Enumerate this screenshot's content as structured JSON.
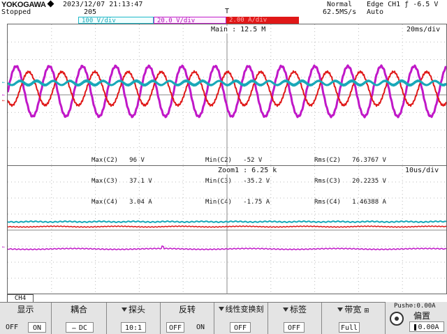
{
  "header": {
    "brand": "YOKOGAWA",
    "datetime": "2023/12/07 21:13:47",
    "status": "Stopped",
    "count": "205",
    "mode": "Normal",
    "sample_rate": "62.5MS/s",
    "trigger": "Edge CH1 ƒ -6.5 V",
    "trigger_mode": "Auto",
    "trigger_mark": "T"
  },
  "channels": [
    {
      "id": "ch2",
      "text": "100 V/div",
      "color": "#18a8b8"
    },
    {
      "id": "ch3",
      "text": "20.0 V/div",
      "color": "#c018c8"
    },
    {
      "id": "ch4",
      "text": "2.00 A/div",
      "color": "#e01818"
    }
  ],
  "main_window": {
    "main_label": "Main : 12.5 M",
    "timebase": "20ms/div",
    "measurements": {
      "max": [
        "Max(C2)   96 V",
        "Max(C3)   37.1 V",
        "Max(C4)   3.04 A"
      ],
      "min": [
        "Min(C2)   -52 V",
        "Min(C3)   -35.2 V",
        "Min(C4)   -1.75 A"
      ],
      "rms": [
        "Rms(C2)   76.3767 V",
        "Rms(C3)   20.2235 V",
        "Rms(C4)   1.46388 A"
      ]
    }
  },
  "zoom_window": {
    "zoom_label": "Zoom1 : 6.25 k",
    "timebase": "10us/div"
  },
  "marker_glyphs": {
    "ch2": "←",
    "ch3": "←",
    "ch4": "←"
  },
  "softkeys": {
    "tab": "CH4",
    "display": {
      "title": "显示",
      "off": "OFF",
      "on": "ON"
    },
    "coupling": {
      "title": "耦合",
      "value": "DC",
      "icon": "dc-coupling-icon"
    },
    "probe": {
      "title": "探头",
      "value": "10:1"
    },
    "invert": {
      "title": "反转",
      "off": "OFF",
      "on": "ON"
    },
    "linear_scale": {
      "title": "线性变换刻",
      "value": "OFF"
    },
    "label": {
      "title": "标签",
      "value": "OFF"
    },
    "bandwidth": {
      "title": "带宽",
      "value": "Full"
    },
    "offset": {
      "push_label": "Push⊘:0.00A",
      "title": "偏置",
      "value": "0.00A"
    }
  }
}
